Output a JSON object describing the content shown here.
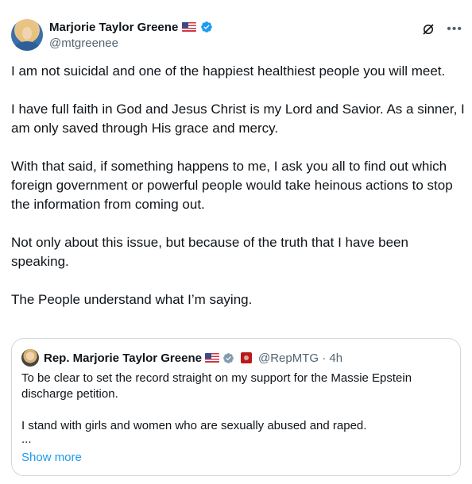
{
  "author": {
    "display_name": "Marjorie Taylor Greene",
    "handle": "@mtgreenee"
  },
  "tweet": {
    "paragraphs": [
      "I am not suicidal and one of the happiest healthiest people you will meet.",
      "I have full faith in God and Jesus Christ is my Lord and Savior. As a sinner, I am only saved through His grace and mercy.",
      "With that said, if something happens to me, I ask you all to find out which foreign government or powerful people would take heinous actions to stop the information from coming out.",
      "Not only about this issue, but because of the truth that I have been speaking.",
      "The People understand what I’m saying."
    ]
  },
  "quote": {
    "display_name": "Rep. Marjorie Taylor Greene",
    "handle_time": "@RepMTG · 4h",
    "paragraphs": [
      "To be clear to set the record straight on my support for the Massie Epstein discharge petition.",
      "I stand with girls and women who are sexually abused and raped."
    ],
    "ellipsis": "...",
    "show_more": "Show more"
  },
  "icons": {
    "verified": "verified-badge-icon",
    "grok": "grok-icon",
    "more": "more-options-icon",
    "flag": "us-flag-icon",
    "gov_badge": "government-badge-icon",
    "seal": "house-seal-icon"
  },
  "colors": {
    "accent": "#1d9bf0",
    "secondary_text": "#536471",
    "border": "#cfd9de",
    "gov_gray": "#829aab"
  }
}
